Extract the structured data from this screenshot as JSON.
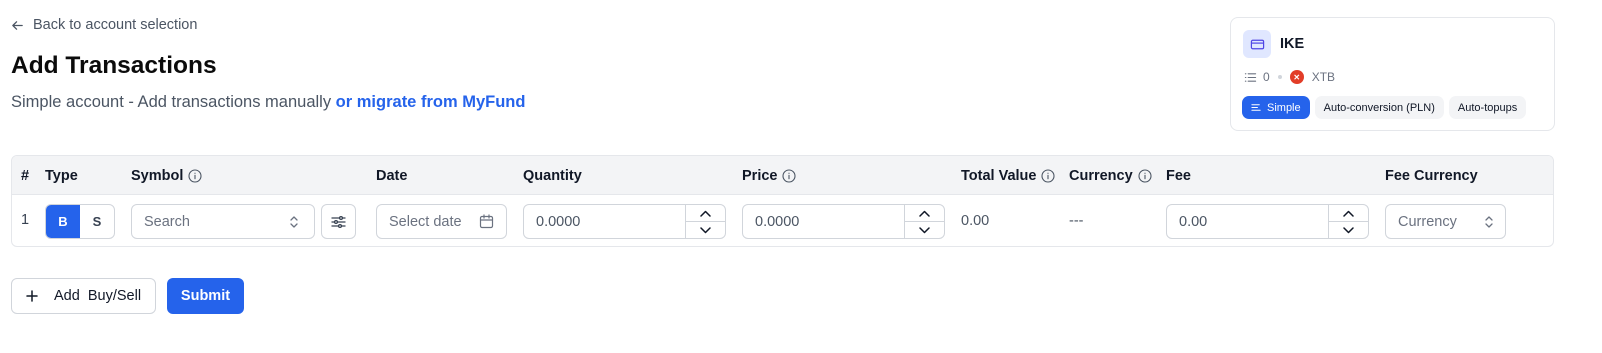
{
  "nav": {
    "back_label": "Back to account selection"
  },
  "page": {
    "title": "Add Transactions",
    "subtitle": "Simple account - Add transactions manually ",
    "subtitle_link": "or migrate from MyFund"
  },
  "account": {
    "name": "IKE",
    "transaction_count": "0",
    "broker": "XTB",
    "tags": [
      "Simple",
      "Auto-conversion (PLN)",
      "Auto-topups"
    ]
  },
  "table": {
    "headers": {
      "num": "#",
      "type": "Type",
      "symbol": "Symbol",
      "date": "Date",
      "quantity": "Quantity",
      "price": "Price",
      "total": "Total Value",
      "currency": "Currency",
      "fee": "Fee",
      "fee_currency": "Fee Currency"
    },
    "row": {
      "num": "1",
      "buy": "B",
      "sell": "S",
      "symbol_placeholder": "Search",
      "date_placeholder": "Select date",
      "quantity": "0.0000",
      "price": "0.0000",
      "total": "0.00",
      "currency": "---",
      "fee": "0.00",
      "fee_currency_placeholder": "Currency"
    }
  },
  "actions": {
    "add_label": "Add",
    "add_type": "Buy/Sell",
    "submit_label": "Submit"
  },
  "colors": {
    "accent": "#2563eb",
    "header_bg": "#f3f4f6",
    "broker": "#e23d28"
  }
}
